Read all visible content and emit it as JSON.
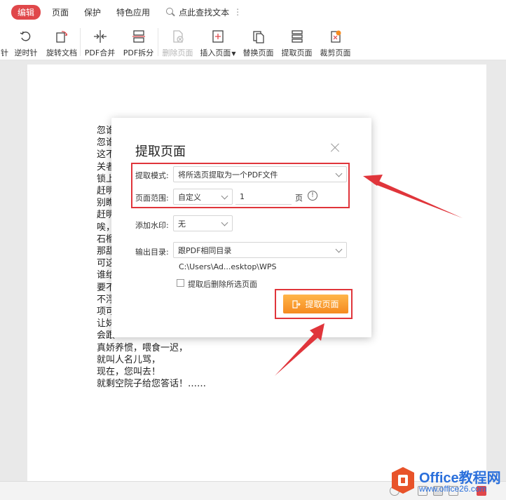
{
  "menu": {
    "tabs": [
      "编辑",
      "页面",
      "保护",
      "特色应用"
    ],
    "search_label": "点此查找文本",
    "more": "⋮"
  },
  "toolbar": {
    "partial_label": "针",
    "items": [
      {
        "label": "逆时针",
        "icon": "rotate-ccw-icon"
      },
      {
        "label": "旋转文档",
        "icon": "rotate-document-icon"
      },
      {
        "label": "PDF合并",
        "icon": "pdf-merge-icon"
      },
      {
        "label": "PDF拆分",
        "icon": "pdf-split-icon"
      },
      {
        "label": "删除页面",
        "icon": "delete-page-icon",
        "disabled": true
      },
      {
        "label": "插入页面",
        "icon": "insert-page-icon",
        "dropdown": true
      },
      {
        "label": "替换页面",
        "icon": "replace-page-icon"
      },
      {
        "label": "提取页面",
        "icon": "extract-page-icon"
      },
      {
        "label": "裁剪页面",
        "icon": "crop-page-icon"
      }
    ]
  },
  "document": {
    "lines": [
      "忽谁",
      "忽谁",
      "这不",
      "关者",
      "锁上",
      "赶明",
      "别瞧",
      "赶明",
      "唉，",
      "石榴",
      "那甜",
      "可这",
      "谁给",
      "要不",
      "不浮",
      "项可",
      "让妹",
      "会跟",
      "真娇养惯，喂食一迟，",
      "就叫人名儿骂，",
      "现在，您叫去！",
      "就剩空院子给您答话！……"
    ]
  },
  "dialog": {
    "title": "提取页面",
    "mode_label": "提取模式:",
    "mode_value": "将所选页提取为一个PDF文件",
    "range_label": "页面范围:",
    "range_value": "自定义",
    "range_input": "1",
    "range_unit": "页",
    "info": "!",
    "watermark_label": "添加水印:",
    "watermark_value": "无",
    "output_label": "输出目录:",
    "output_value": "跟PDF相同目录",
    "output_path": "C:\\Users\\Ad...esktop\\WPS",
    "delete_after_label": "提取后删除所选页面",
    "delete_after_checked": false,
    "submit_label": "提取页面"
  },
  "watermark": {
    "title": "Office教程网",
    "url": "www.office26.com"
  },
  "colors": {
    "accent_red": "#e0474a",
    "annotation_red": "#e0353b",
    "button_orange": "#f58a1f",
    "watermark_blue": "#2a6fdb"
  }
}
